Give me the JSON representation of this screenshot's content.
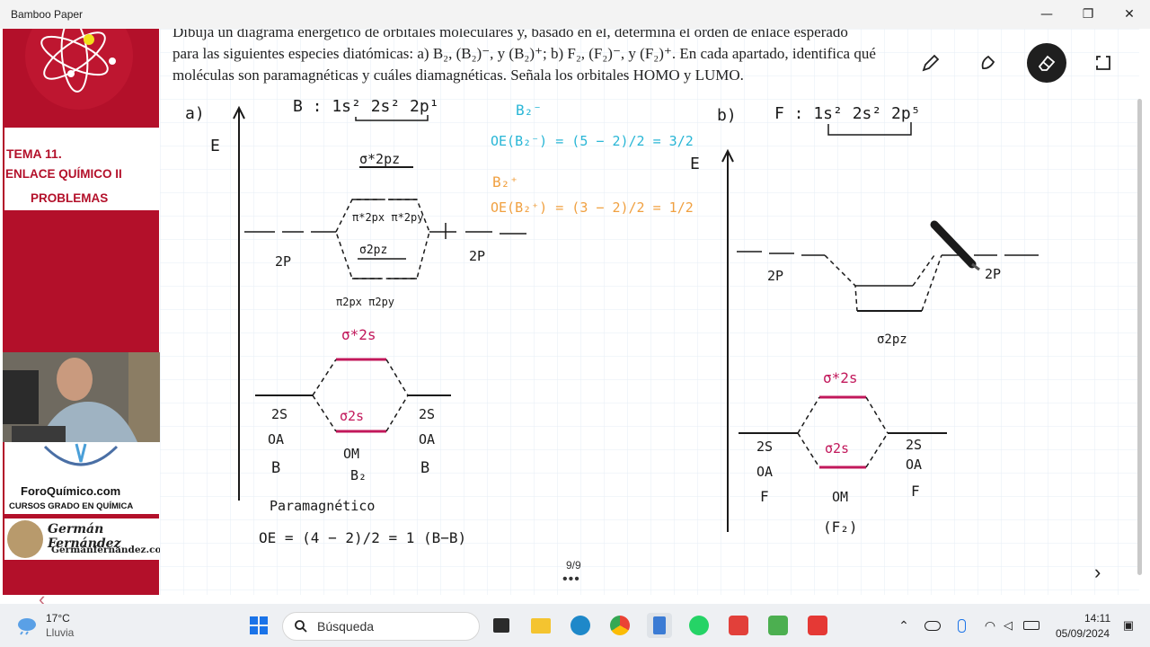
{
  "window": {
    "app_title": "Bamboo Paper",
    "minimize_glyph": "—",
    "maximize_glyph": "❐",
    "close_glyph": "✕"
  },
  "sidebar": {
    "tema_title": "TEMA 11.",
    "tema_subtitle": "ENLACE QUÍMICO II",
    "tema_problems": "PROBLEMAS",
    "logo_name": "ForoQuímico.com",
    "logo_sub": "CURSOS GRADO EN QUÍMICA",
    "author_name": "Germán Fernández",
    "author_site": "Germánfernandez.com",
    "prev_glyph": "‹"
  },
  "document": {
    "problem_line1": "Dibuja un diagrama energético de orbitales moleculares y, basado en él, determina el orden de enlace esperado",
    "problem_line2": "para las siguientes especies diatómicas: a) B₂, (B₂)⁻, y (B₂)⁺; b) F₂, (F₂)⁻, y (F₂)⁺. En cada apartado, identifica qué",
    "problem_line3": "moléculas son paramagnéticas y cuáles diamagnéticas. Señala los orbitales HOMO y LUMO.",
    "page_indicator": "9/9",
    "more": "•••",
    "next_glyph": "›",
    "ink": {
      "a": "a)",
      "b": "b)",
      "b_config": "B : 1s² 2s² 2p¹",
      "f_config": "F : 1s² 2s² 2p⁵",
      "energy": "E",
      "p2": "2P",
      "sigma2pz_star": "σ*2pz",
      "pi_star": "π*2px π*2py",
      "sigma2pz": "σ2pz",
      "pi": "π2px π2py",
      "sigma2s_star": "σ*2s",
      "sigma2s": "σ2s",
      "s2": "2S",
      "oa": "OA",
      "om": "OM",
      "b_atom": "B",
      "b2": "B₂",
      "f_atom": "F",
      "f2": "(F₂)",
      "paramagnetic": "Paramagnético",
      "oe_b2": "OE = (4 − 2)/2 = 1 (B−B)",
      "b2_minus": "B₂⁻",
      "oe_b2_minus": "OE(B₂⁻) = (5 − 2)/2 = 3/2",
      "b2_plus": "B₂⁺",
      "oe_b2_plus": "OE(B₂⁺) = (3 − 2)/2 = 1/2",
      "sigma2pz_f": "σ2pz"
    }
  },
  "taskbar": {
    "weather_temp": "17°C",
    "weather_desc": "Lluvia",
    "search_placeholder": "Búsqueda",
    "time": "14:11",
    "date": "05/09/2024"
  },
  "colors": {
    "sidebar": "#b3102a",
    "ink_black": "#1a1a1a",
    "ink_magenta": "#c2185b",
    "ink_cyan": "#29b6d6",
    "ink_orange": "#f0a040"
  }
}
